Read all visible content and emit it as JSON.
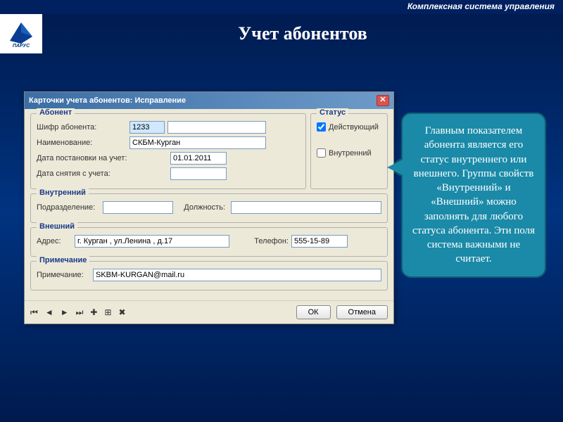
{
  "banner": "Комплексная система управления",
  "page_title": "Учет абонентов",
  "dialog": {
    "title": "Карточки учета абонентов: Исправление",
    "groups": {
      "abonent": {
        "legend": "Абонент",
        "code_label": "Шифр абонента:",
        "code_value": "1233",
        "name_label": "Наименование:",
        "name_value": "СКБМ-Курган",
        "reg_date_label": "Дата постановки на учет:",
        "reg_date_value": "01.01.2011",
        "dereg_date_label": "Дата снятия с учета:",
        "dereg_date_value": ""
      },
      "status": {
        "legend": "Статус",
        "active_label": "Действующий",
        "active_checked": true,
        "internal_label": "Внутренний",
        "internal_checked": false
      },
      "internal": {
        "legend": "Внутренний",
        "dept_label": "Подразделение:",
        "dept_value": "",
        "position_label": "Должность:",
        "position_value": ""
      },
      "external": {
        "legend": "Внешний",
        "address_label": "Адрес:",
        "address_value": "г. Курган , ул.Ленина , д.17",
        "phone_label": "Телефон:",
        "phone_value": "555-15-89"
      },
      "note": {
        "legend": "Примечание",
        "note_label": "Примечание:",
        "note_value": "SKBM-KURGAN@mail.ru"
      }
    },
    "buttons": {
      "ok": "ОК",
      "cancel": "Отмена"
    }
  },
  "callout": "Главным показателем абонента является его статус внутреннего или внешнего. Группы свойств «Внутренний» и «Внешний» можно заполнять для любого статуса абонента. Эти поля система важными не считает."
}
